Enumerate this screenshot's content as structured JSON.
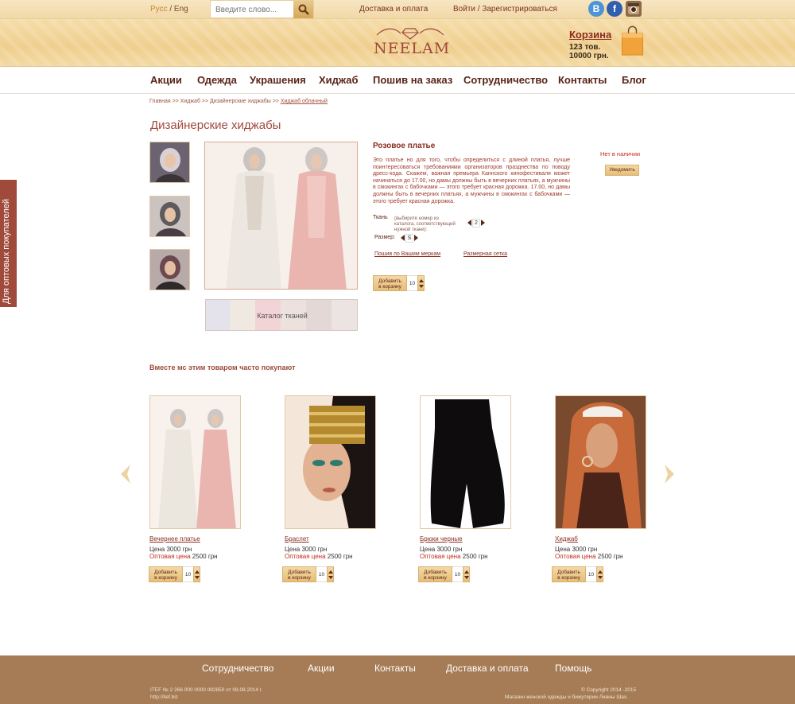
{
  "topbar": {
    "lang_ru": "Русс",
    "lang_sep": "/",
    "lang_en": "Eng",
    "search_placeholder": "Введите слово...",
    "delivery": "Доставка и оплата",
    "login": "Войти / Зарегистрироваться",
    "social": [
      "vk-icon",
      "facebook-icon",
      "instagram-icon"
    ]
  },
  "header": {
    "logo": "NEELAM",
    "cart_title": "Корзина",
    "cart_items": "123 тов.",
    "cart_total": "10000 грн."
  },
  "nav": [
    "Акции",
    "Одежда",
    "Украшения",
    "Хиджаб",
    "Пошив на заказ",
    "Сотрудничество",
    "Контакты",
    "Блог"
  ],
  "breadcrumb": {
    "path": "Главная >> Хиджаб >> Дизайнерские хиджабы >> ",
    "current": "Хиджаб облачный"
  },
  "page_title": "Дизайнерские хиджабы",
  "side_tab": "Для оптовых покупателей",
  "catalog_label": "Каталог тканей",
  "product": {
    "name": "Розовое платье",
    "description": "Это платье но для того, чтобы определиться с длиной платья, лучше поинтересоваться требованиями организаторов празднества по поводу дресс-кода. Скажем, важная премьера Каннского кинофестиваля может начинаться до 17.00, но дамы должны быть в вечерних платьях, а мужчины в смокингах с бабочками — этого требует красная дорожка. 17.00, но дамы должны быть в вечерних платьях, а мужчины в смокингах с бабочками — этого требует красная дорожка.",
    "fabric_label": "Ткань",
    "fabric_note": "(выбирите номер из каталога, соответствующий нужной ткани):",
    "fabric_value": "2",
    "size_label": "Размер:",
    "size_value": "S",
    "custom_link": "Пошив по Вашим меркам",
    "size_chart_link": "Размерная сетка",
    "add_label_1": "Добавить",
    "add_label_2": "в корзину",
    "qty": "10",
    "stock": "Нет в наличии",
    "notify": "Уведомить"
  },
  "related_title": "Вместе мс этим товаром часто покупают",
  "related": [
    {
      "name": "Вечернее платье",
      "price_label": "Цена",
      "price": "3000 грн",
      "whole_label": "Оптовая цена",
      "whole": "2500 грн",
      "qty": "10"
    },
    {
      "name": "Браслет",
      "price_label": "Цена",
      "price": "3000 грн",
      "whole_label": "Оптовая цена",
      "whole": "2500 грн",
      "qty": "10"
    },
    {
      "name": "Брюки черные",
      "price_label": "Цена",
      "price": "3000 грн",
      "whole_label": "Оптовая цена",
      "whole": "2500 грн",
      "qty": "10"
    },
    {
      "name": "Хиджаб",
      "price_label": "Цена",
      "price": "3000 грн",
      "whole_label": "Оптовая цена",
      "whole": "2500 грн",
      "qty": "10"
    }
  ],
  "footer": {
    "links": [
      "Сотрудничество",
      "Акции",
      "Контакты",
      "Доставка и оплата",
      "Помощь"
    ],
    "itef_line1": "ITEF  № 2 266 000 0000 082850 от 08.08.2014 г.",
    "itef_line2": "http://itef.biz",
    "copyright": "© Copyright 2014 -2015",
    "shop": "Магазин женской одежды и бижутерии Лианы Шах."
  },
  "colors": {
    "accent": "#a14a3c",
    "gold": "#f0cf8e",
    "footer": "#a67c56",
    "sale": "#c22b1f"
  }
}
